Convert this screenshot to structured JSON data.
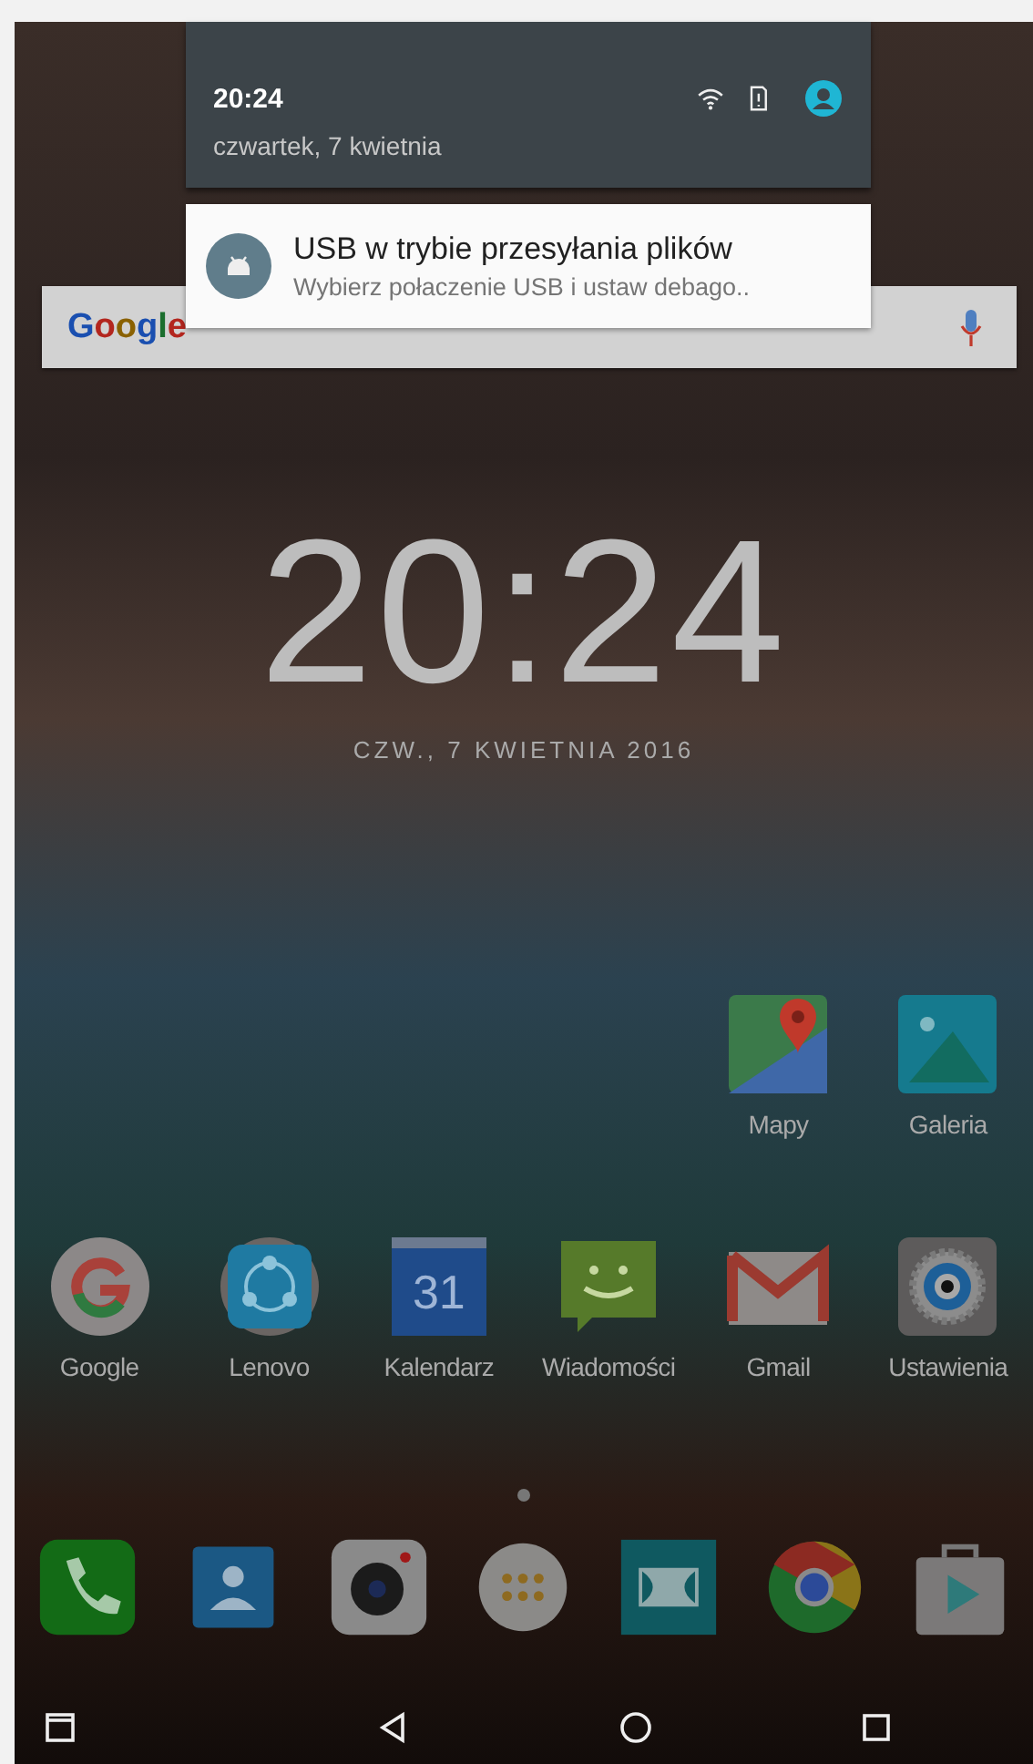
{
  "notification_shade": {
    "time": "20:24",
    "date": "czwartek, 7 kwietnia"
  },
  "notification": {
    "title": "USB w trybie przesyłania plików",
    "text": "Wybierz połaczenie USB i ustaw debago.."
  },
  "search_bar": {
    "logo": "Google"
  },
  "clock": {
    "time": "20:24",
    "date": "CZW., 7 KWIETNIA 2016"
  },
  "apps_top": [
    {
      "label": "Mapy",
      "kind": "maps"
    },
    {
      "label": "Galeria",
      "kind": "gallery"
    }
  ],
  "apps": [
    {
      "label": "Google",
      "kind": "google"
    },
    {
      "label": "Lenovo",
      "kind": "share"
    },
    {
      "label": "Kalendarz",
      "kind": "calendar",
      "badge": "31"
    },
    {
      "label": "Wiadomości",
      "kind": "messages"
    },
    {
      "label": "Gmail",
      "kind": "mail"
    },
    {
      "label": "Ustawienia",
      "kind": "settings"
    }
  ],
  "dock": [
    {
      "kind": "phone"
    },
    {
      "kind": "contacts"
    },
    {
      "kind": "camera"
    },
    {
      "kind": "drawer"
    },
    {
      "kind": "dolby"
    },
    {
      "kind": "chrome"
    },
    {
      "kind": "store"
    }
  ],
  "nav_bar": [
    {
      "kind": "window"
    },
    {
      "kind": "back"
    },
    {
      "kind": "home"
    },
    {
      "kind": "recents"
    }
  ]
}
